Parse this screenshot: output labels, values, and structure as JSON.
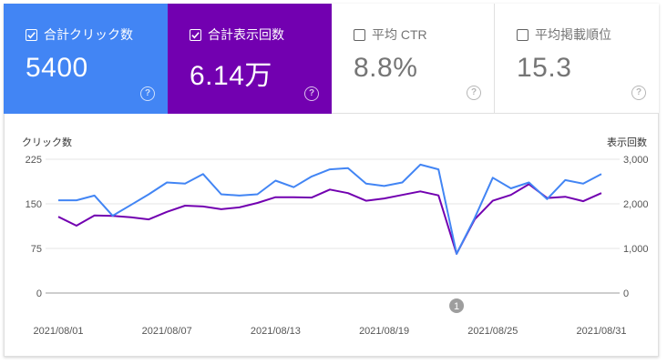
{
  "metrics": [
    {
      "label": "合計クリック数",
      "value": "5400",
      "checked": true
    },
    {
      "label": "合計表示回数",
      "value": "6.14万",
      "checked": true
    },
    {
      "label": "平均 CTR",
      "value": "8.8%",
      "checked": false
    },
    {
      "label": "平均掲載順位",
      "value": "15.3",
      "checked": false
    }
  ],
  "icons": {
    "checkbox": "checkbox-icon",
    "help": "help-circle-icon"
  },
  "help_glyph": "?",
  "colors": {
    "clicks": "#4285f4",
    "impressions": "#7200b0",
    "grid": "#e6e6e6",
    "axis": "#9e9e9e"
  },
  "chart_data": {
    "type": "line",
    "ylabel": "クリック数",
    "y2label": "表示回数",
    "ylim": [
      0,
      225
    ],
    "y2lim": [
      0,
      3000
    ],
    "yticks": [
      "0",
      "75",
      "150",
      "225"
    ],
    "y2ticks": [
      "0",
      "1,000",
      "2,000",
      "3,000"
    ],
    "xtick_labels": [
      "2021/08/01",
      "2021/08/07",
      "2021/08/13",
      "2021/08/19",
      "2021/08/25",
      "2021/08/31"
    ],
    "x": [
      "2021/08/01",
      "2021/08/02",
      "2021/08/03",
      "2021/08/04",
      "2021/08/05",
      "2021/08/06",
      "2021/08/07",
      "2021/08/08",
      "2021/08/09",
      "2021/08/10",
      "2021/08/11",
      "2021/08/12",
      "2021/08/13",
      "2021/08/14",
      "2021/08/15",
      "2021/08/16",
      "2021/08/17",
      "2021/08/18",
      "2021/08/19",
      "2021/08/20",
      "2021/08/21",
      "2021/08/22",
      "2021/08/23",
      "2021/08/24",
      "2021/08/25",
      "2021/08/26",
      "2021/08/27",
      "2021/08/28",
      "2021/08/29",
      "2021/08/30",
      "2021/08/31"
    ],
    "annotation": {
      "label": "1",
      "x": "2021/08/23"
    },
    "series": [
      {
        "axis": "left",
        "values": [
          156,
          156,
          164,
          130,
          148,
          166,
          186,
          184,
          200,
          166,
          164,
          166,
          189,
          178,
          196,
          208,
          210,
          184,
          180,
          186,
          216,
          208,
          66,
          126,
          194,
          176,
          186,
          158,
          190,
          184,
          200
        ]
      },
      {
        "axis": "right",
        "values": [
          1710,
          1510,
          1740,
          1730,
          1700,
          1650,
          1820,
          1960,
          1940,
          1880,
          1920,
          2020,
          2150,
          2150,
          2140,
          2320,
          2240,
          2070,
          2120,
          2200,
          2280,
          2190,
          880,
          1650,
          2070,
          2200,
          2440,
          2130,
          2160,
          2060,
          2240
        ]
      }
    ]
  }
}
